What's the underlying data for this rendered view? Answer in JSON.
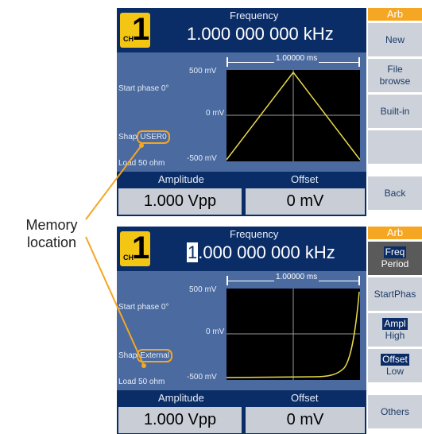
{
  "callout": {
    "line1": "Memory",
    "line2": "location",
    "color": "#f5a623"
  },
  "colors": {
    "header_bg": "#0b2d67",
    "plot_panel_bg": "#4a6aa0",
    "channel_badge": "#f3c613",
    "arb_accent": "#f5a623",
    "trace": "#e8d84a",
    "softkey_bg": "#cdd2da"
  },
  "screens": [
    {
      "channel": {
        "ch_label": "CH",
        "number": "1"
      },
      "frequency": {
        "label": "Frequency",
        "value": "1.000 000 000 kHz"
      },
      "plot": {
        "period": "1.00000 ms",
        "y_top": "500 mV",
        "y_mid": "0 mV",
        "y_bottom": "-500 mV",
        "start_phase": "Start phase 0°",
        "shape_label": "Shap",
        "shape_value": "USER0",
        "load": "Load 50 ohm",
        "waveform": "triangle"
      },
      "amplitude": {
        "label": "Amplitude",
        "value": "1.000 Vpp"
      },
      "offset": {
        "label": "Offset",
        "value": "0 mV"
      },
      "softkeys": {
        "header": "Arb",
        "keys": [
          {
            "label": "New"
          },
          {
            "label": "File",
            "sub": "browse"
          },
          {
            "label": "Built-in"
          },
          {
            "label": ""
          },
          {
            "label": "Back"
          }
        ]
      }
    },
    {
      "channel": {
        "ch_label": "CH",
        "number": "1"
      },
      "frequency": {
        "label": "Frequency",
        "value_cursor": "1",
        "value_rest": ".000 000 000 kHz"
      },
      "plot": {
        "period": "1.00000 ms",
        "y_top": "500 mV",
        "y_mid": "0 mV",
        "y_bottom": "-500 mV",
        "start_phase": "Start phase 0°",
        "shape_label": "Shap",
        "shape_value": "External",
        "load": "Load 50 ohm",
        "waveform": "exponential-rise"
      },
      "amplitude": {
        "label": "Amplitude",
        "value": "1.000 Vpp"
      },
      "offset": {
        "label": "Offset",
        "value": "0 mV"
      },
      "softkeys": {
        "header": "Arb",
        "keys": [
          {
            "label": "Freq",
            "sub": "Period",
            "selected": true
          },
          {
            "label": "StartPhas"
          },
          {
            "label": "Ampl",
            "sub": "High"
          },
          {
            "label": "Offset",
            "sub": "Low"
          },
          {
            "label": "Others"
          }
        ]
      }
    }
  ]
}
